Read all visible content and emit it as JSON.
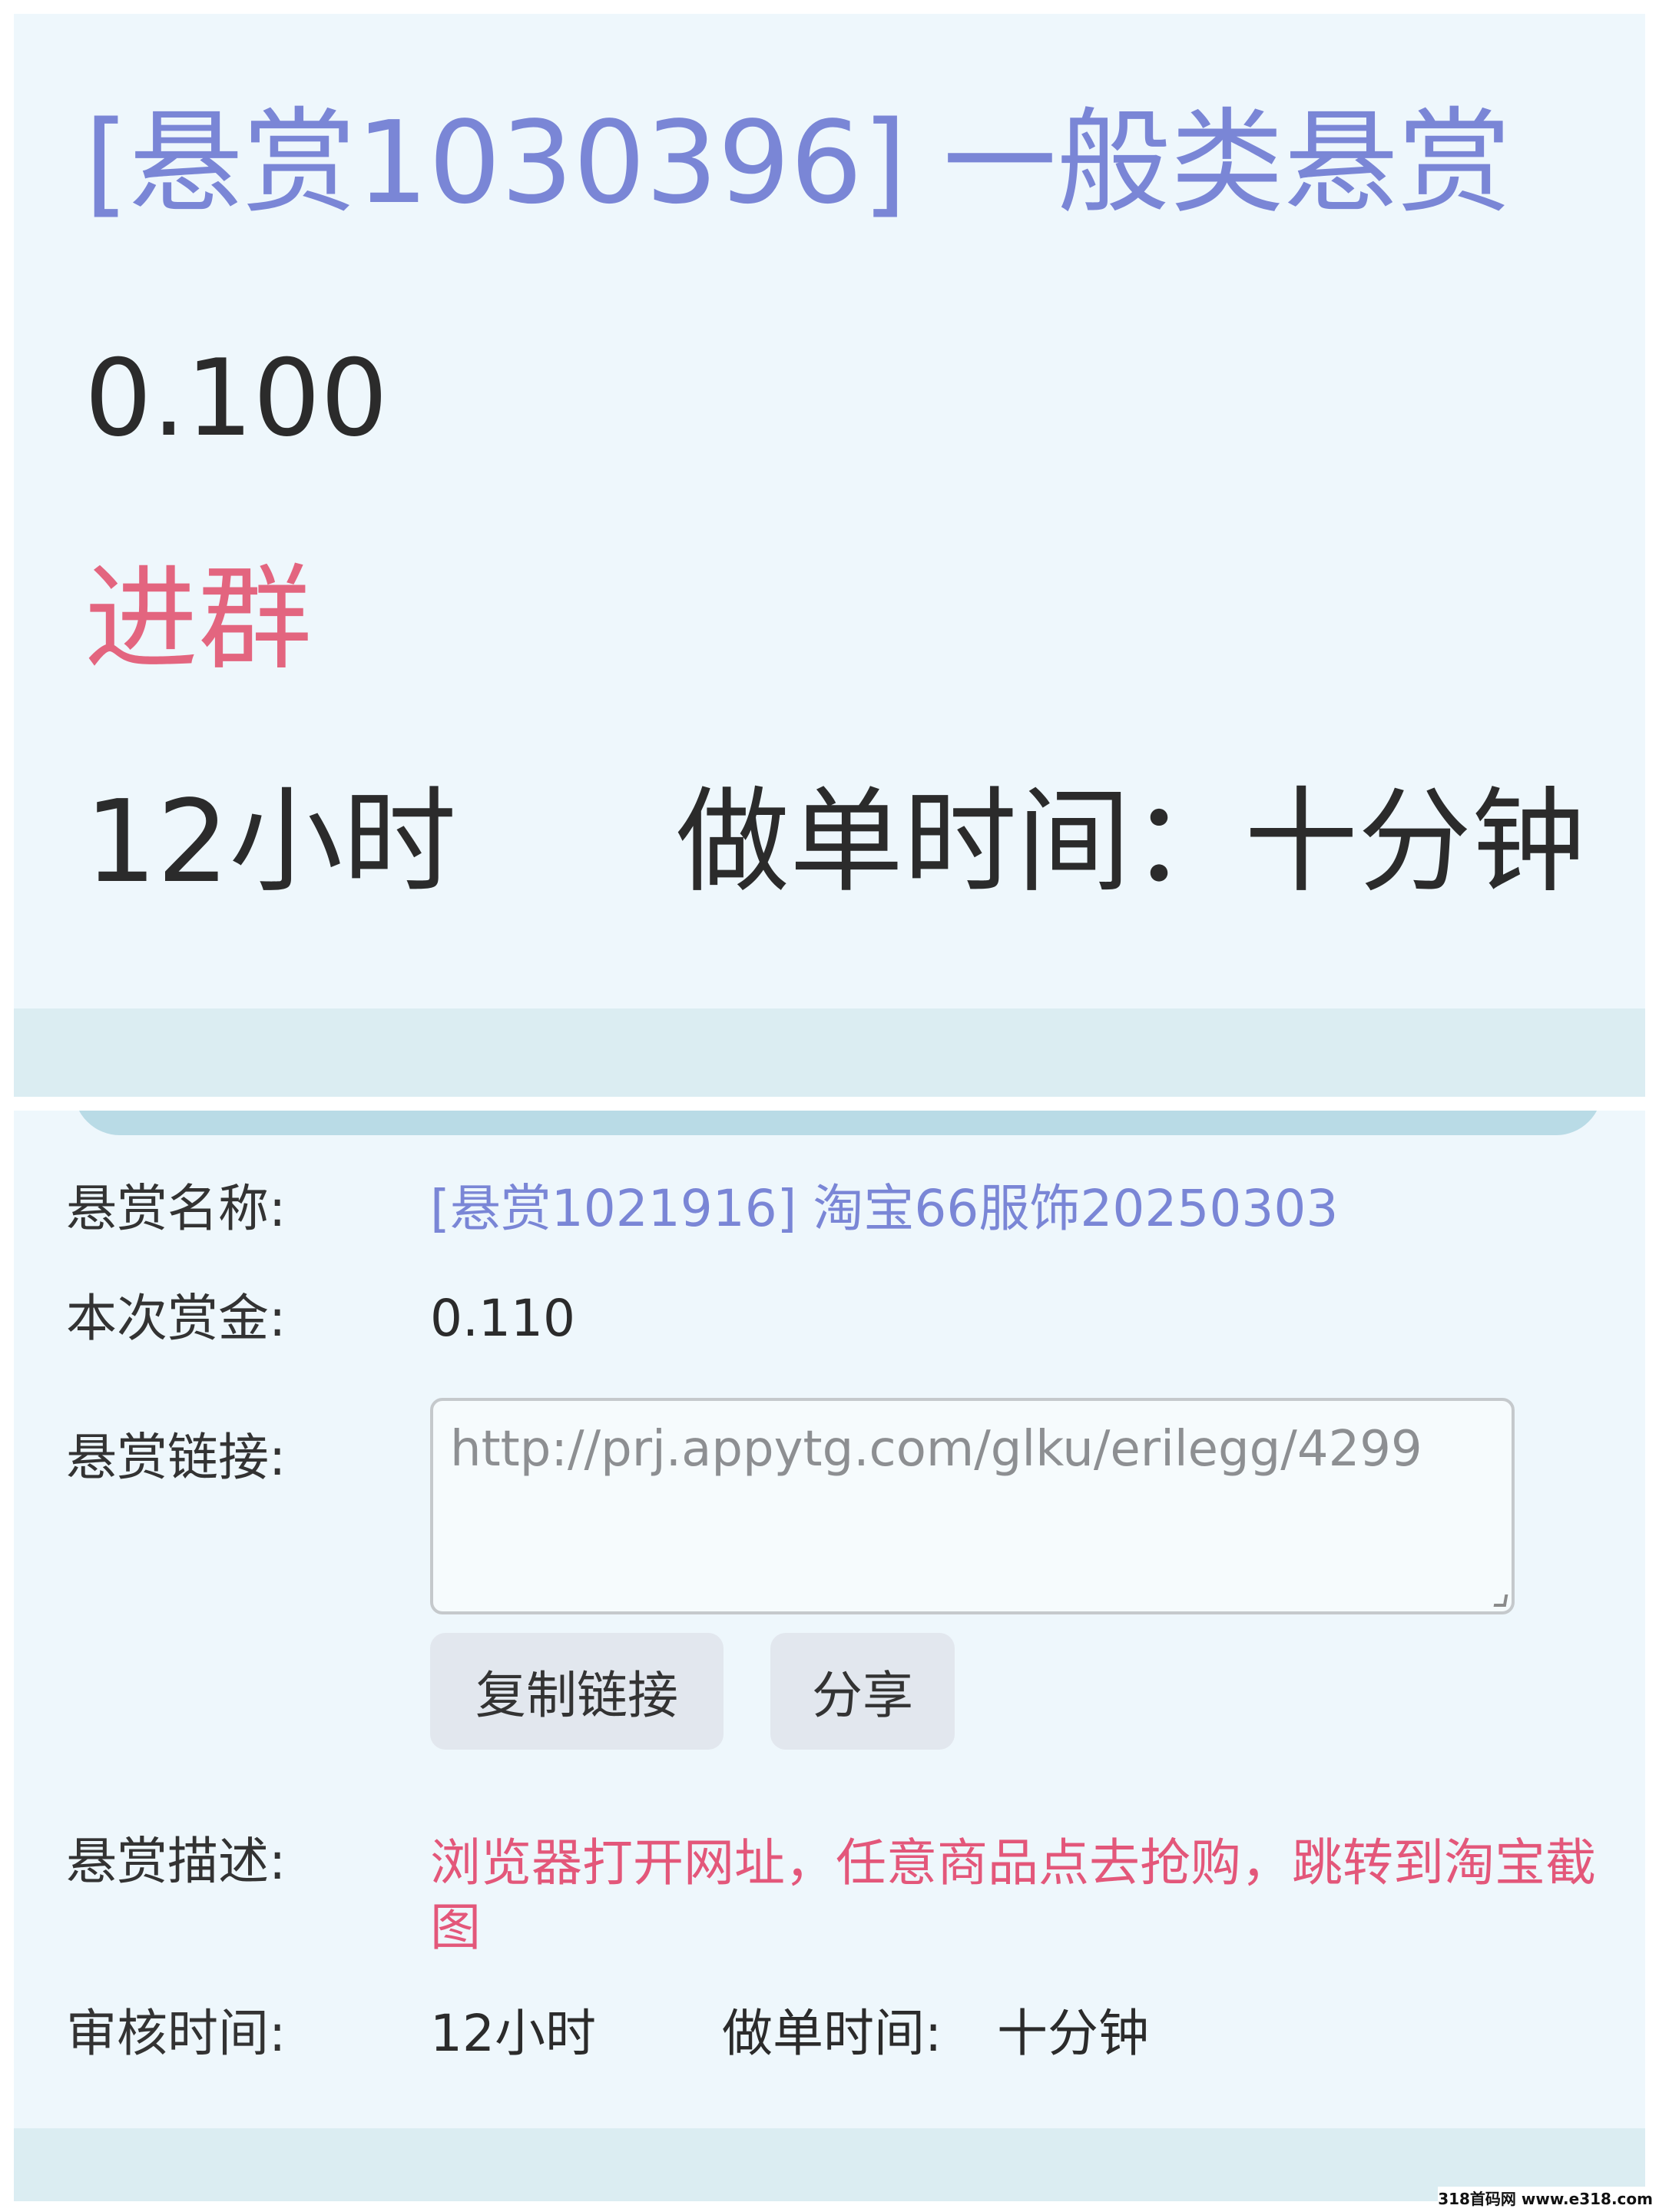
{
  "top_card": {
    "title": "[悬赏1030396] 一般类悬赏",
    "amount": "0.100",
    "link_text": "进群",
    "review_time": "12小时",
    "work_time": "做单时间：十分钟"
  },
  "detail_card": {
    "name_label": "悬赏名称:",
    "name_value": "[悬赏1021916] 淘宝66服饰20250303",
    "bounty_label": "本次赏金:",
    "bounty_value": "0.110",
    "link_label": "悬赏链接:",
    "link_value": "http://prj.appytg.com/glku/erilegg/4299",
    "copy_button": "复制链接",
    "share_button": "分享",
    "desc_label": "悬赏描述:",
    "desc_value": "浏览器打开网址，任意商品点去抢购，跳转到淘宝截图",
    "review_label": "审核时间:",
    "review_value": "12小时",
    "work_label": "做单时间:",
    "work_value": "十分钟"
  },
  "watermark": "318首码网 www.e318.com",
  "colors": {
    "title": "#7a86d6",
    "accent_red": "#e3577a",
    "card_bg": "#eef7fc",
    "band": "#dbedf2"
  }
}
